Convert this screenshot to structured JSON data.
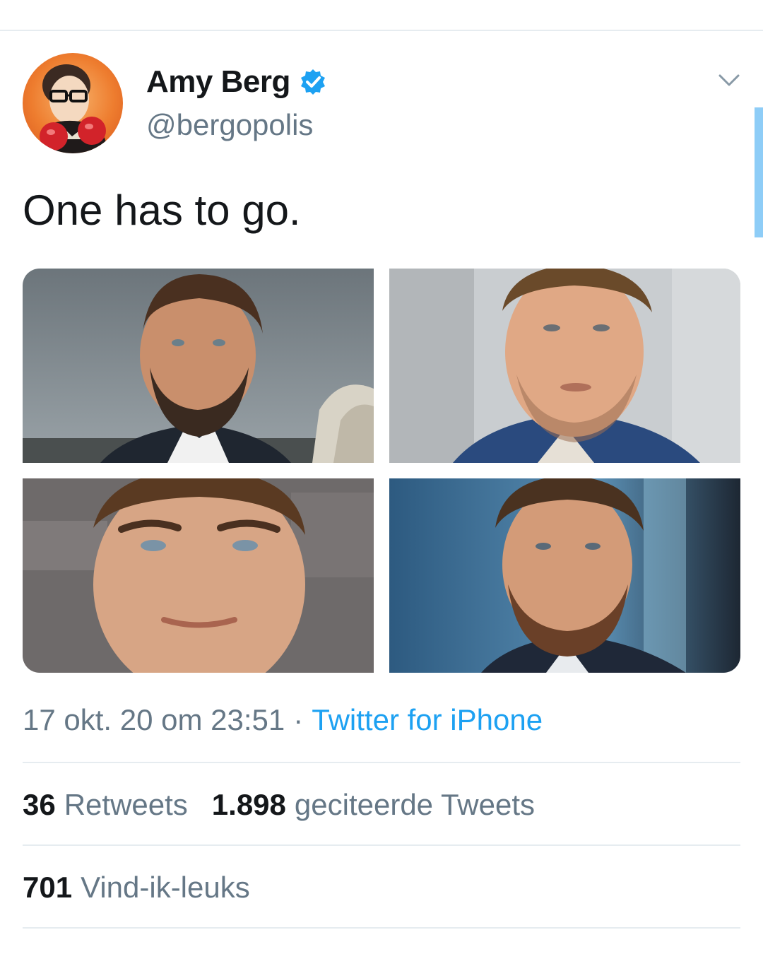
{
  "tweet": {
    "author": {
      "display_name": "Amy Berg",
      "handle": "@bergopolis",
      "verified": true
    },
    "text": "One has to go.",
    "timestamp": "17 okt. 20 om 23:51",
    "separator": "·",
    "source": "Twitter for iPhone"
  },
  "stats": {
    "retweets": {
      "count": "36",
      "label": "Retweets"
    },
    "quote_tweets": {
      "count": "1.898",
      "label": "geciteerde Tweets"
    },
    "likes": {
      "count": "701",
      "label": "Vind-ik-leuks"
    }
  },
  "colors": {
    "text_primary": "#14171a",
    "text_secondary": "#657786",
    "link": "#1da1f2",
    "divider": "#e6ecf0",
    "verified": "#1da1f2"
  },
  "icons": {
    "verified": "verified-badge-icon",
    "more": "chevron-down-icon"
  }
}
